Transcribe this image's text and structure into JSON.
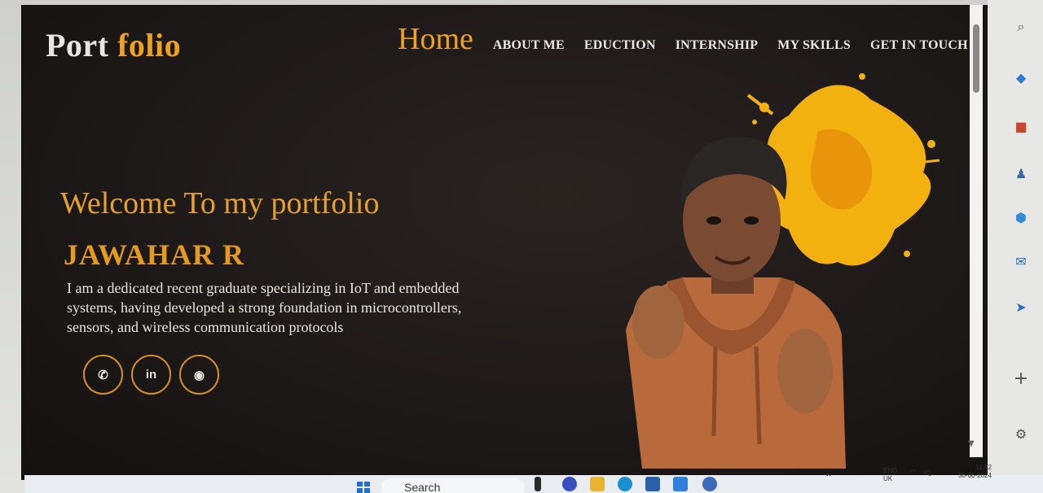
{
  "logo": {
    "part1": "Port",
    "part2": "folio"
  },
  "nav": {
    "home": "Home",
    "items": [
      "ABOUT ME",
      "EDUCTION",
      "INTERNSHIP",
      "MY SKILLS",
      "GET IN TOUCH"
    ]
  },
  "hero": {
    "welcome": "Welcome To my portfolio",
    "name": "JAWAHAR R",
    "description": "I am a dedicated recent graduate specializing in IoT and embedded systems, having developed a strong foundation in microcontrollers, sensors, and wireless communication protocols"
  },
  "socials": [
    {
      "icon": "whatsapp-icon",
      "glyph": "✆"
    },
    {
      "icon": "linkedin-icon",
      "glyph": "in"
    },
    {
      "icon": "github-icon",
      "glyph": "◉"
    }
  ],
  "taskbar": {
    "search_label": "Search",
    "lang": "ENG",
    "region": "UK",
    "time": "11:42",
    "date": "30-06-2024"
  },
  "colors": {
    "accent": "#f0a21a",
    "page_bg": "#1d1918",
    "text_light": "#ece8e2"
  }
}
